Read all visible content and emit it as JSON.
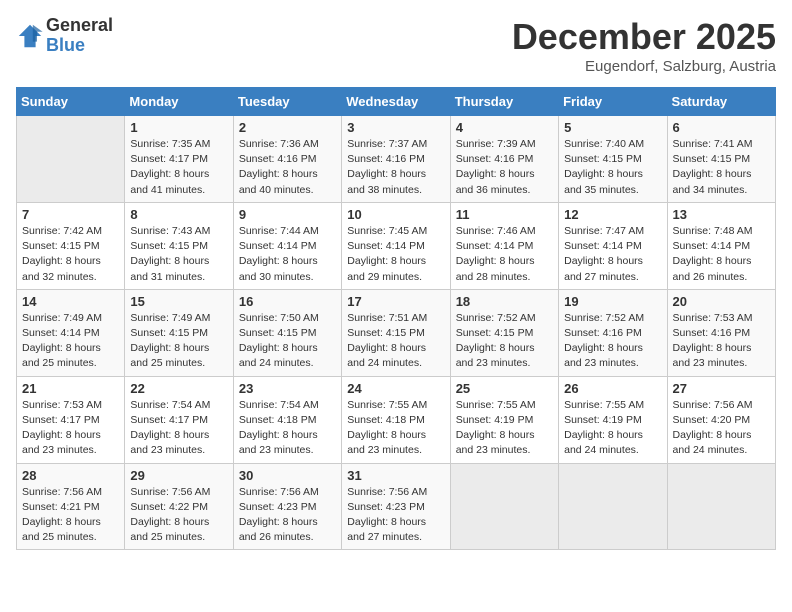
{
  "header": {
    "logo_general": "General",
    "logo_blue": "Blue",
    "month_title": "December 2025",
    "subtitle": "Eugendorf, Salzburg, Austria"
  },
  "days_of_week": [
    "Sunday",
    "Monday",
    "Tuesday",
    "Wednesday",
    "Thursday",
    "Friday",
    "Saturday"
  ],
  "weeks": [
    [
      {
        "day": "",
        "sunrise": "",
        "sunset": "",
        "daylight": "",
        "empty": true
      },
      {
        "day": "1",
        "sunrise": "Sunrise: 7:35 AM",
        "sunset": "Sunset: 4:17 PM",
        "daylight": "Daylight: 8 hours and 41 minutes."
      },
      {
        "day": "2",
        "sunrise": "Sunrise: 7:36 AM",
        "sunset": "Sunset: 4:16 PM",
        "daylight": "Daylight: 8 hours and 40 minutes."
      },
      {
        "day": "3",
        "sunrise": "Sunrise: 7:37 AM",
        "sunset": "Sunset: 4:16 PM",
        "daylight": "Daylight: 8 hours and 38 minutes."
      },
      {
        "day": "4",
        "sunrise": "Sunrise: 7:39 AM",
        "sunset": "Sunset: 4:16 PM",
        "daylight": "Daylight: 8 hours and 36 minutes."
      },
      {
        "day": "5",
        "sunrise": "Sunrise: 7:40 AM",
        "sunset": "Sunset: 4:15 PM",
        "daylight": "Daylight: 8 hours and 35 minutes."
      },
      {
        "day": "6",
        "sunrise": "Sunrise: 7:41 AM",
        "sunset": "Sunset: 4:15 PM",
        "daylight": "Daylight: 8 hours and 34 minutes."
      }
    ],
    [
      {
        "day": "7",
        "sunrise": "Sunrise: 7:42 AM",
        "sunset": "Sunset: 4:15 PM",
        "daylight": "Daylight: 8 hours and 32 minutes."
      },
      {
        "day": "8",
        "sunrise": "Sunrise: 7:43 AM",
        "sunset": "Sunset: 4:15 PM",
        "daylight": "Daylight: 8 hours and 31 minutes."
      },
      {
        "day": "9",
        "sunrise": "Sunrise: 7:44 AM",
        "sunset": "Sunset: 4:14 PM",
        "daylight": "Daylight: 8 hours and 30 minutes."
      },
      {
        "day": "10",
        "sunrise": "Sunrise: 7:45 AM",
        "sunset": "Sunset: 4:14 PM",
        "daylight": "Daylight: 8 hours and 29 minutes."
      },
      {
        "day": "11",
        "sunrise": "Sunrise: 7:46 AM",
        "sunset": "Sunset: 4:14 PM",
        "daylight": "Daylight: 8 hours and 28 minutes."
      },
      {
        "day": "12",
        "sunrise": "Sunrise: 7:47 AM",
        "sunset": "Sunset: 4:14 PM",
        "daylight": "Daylight: 8 hours and 27 minutes."
      },
      {
        "day": "13",
        "sunrise": "Sunrise: 7:48 AM",
        "sunset": "Sunset: 4:14 PM",
        "daylight": "Daylight: 8 hours and 26 minutes."
      }
    ],
    [
      {
        "day": "14",
        "sunrise": "Sunrise: 7:49 AM",
        "sunset": "Sunset: 4:14 PM",
        "daylight": "Daylight: 8 hours and 25 minutes."
      },
      {
        "day": "15",
        "sunrise": "Sunrise: 7:49 AM",
        "sunset": "Sunset: 4:15 PM",
        "daylight": "Daylight: 8 hours and 25 minutes."
      },
      {
        "day": "16",
        "sunrise": "Sunrise: 7:50 AM",
        "sunset": "Sunset: 4:15 PM",
        "daylight": "Daylight: 8 hours and 24 minutes."
      },
      {
        "day": "17",
        "sunrise": "Sunrise: 7:51 AM",
        "sunset": "Sunset: 4:15 PM",
        "daylight": "Daylight: 8 hours and 24 minutes."
      },
      {
        "day": "18",
        "sunrise": "Sunrise: 7:52 AM",
        "sunset": "Sunset: 4:15 PM",
        "daylight": "Daylight: 8 hours and 23 minutes."
      },
      {
        "day": "19",
        "sunrise": "Sunrise: 7:52 AM",
        "sunset": "Sunset: 4:16 PM",
        "daylight": "Daylight: 8 hours and 23 minutes."
      },
      {
        "day": "20",
        "sunrise": "Sunrise: 7:53 AM",
        "sunset": "Sunset: 4:16 PM",
        "daylight": "Daylight: 8 hours and 23 minutes."
      }
    ],
    [
      {
        "day": "21",
        "sunrise": "Sunrise: 7:53 AM",
        "sunset": "Sunset: 4:17 PM",
        "daylight": "Daylight: 8 hours and 23 minutes."
      },
      {
        "day": "22",
        "sunrise": "Sunrise: 7:54 AM",
        "sunset": "Sunset: 4:17 PM",
        "daylight": "Daylight: 8 hours and 23 minutes."
      },
      {
        "day": "23",
        "sunrise": "Sunrise: 7:54 AM",
        "sunset": "Sunset: 4:18 PM",
        "daylight": "Daylight: 8 hours and 23 minutes."
      },
      {
        "day": "24",
        "sunrise": "Sunrise: 7:55 AM",
        "sunset": "Sunset: 4:18 PM",
        "daylight": "Daylight: 8 hours and 23 minutes."
      },
      {
        "day": "25",
        "sunrise": "Sunrise: 7:55 AM",
        "sunset": "Sunset: 4:19 PM",
        "daylight": "Daylight: 8 hours and 23 minutes."
      },
      {
        "day": "26",
        "sunrise": "Sunrise: 7:55 AM",
        "sunset": "Sunset: 4:19 PM",
        "daylight": "Daylight: 8 hours and 24 minutes."
      },
      {
        "day": "27",
        "sunrise": "Sunrise: 7:56 AM",
        "sunset": "Sunset: 4:20 PM",
        "daylight": "Daylight: 8 hours and 24 minutes."
      }
    ],
    [
      {
        "day": "28",
        "sunrise": "Sunrise: 7:56 AM",
        "sunset": "Sunset: 4:21 PM",
        "daylight": "Daylight: 8 hours and 25 minutes."
      },
      {
        "day": "29",
        "sunrise": "Sunrise: 7:56 AM",
        "sunset": "Sunset: 4:22 PM",
        "daylight": "Daylight: 8 hours and 25 minutes."
      },
      {
        "day": "30",
        "sunrise": "Sunrise: 7:56 AM",
        "sunset": "Sunset: 4:23 PM",
        "daylight": "Daylight: 8 hours and 26 minutes."
      },
      {
        "day": "31",
        "sunrise": "Sunrise: 7:56 AM",
        "sunset": "Sunset: 4:23 PM",
        "daylight": "Daylight: 8 hours and 27 minutes."
      },
      {
        "day": "",
        "sunrise": "",
        "sunset": "",
        "daylight": "",
        "empty": true
      },
      {
        "day": "",
        "sunrise": "",
        "sunset": "",
        "daylight": "",
        "empty": true
      },
      {
        "day": "",
        "sunrise": "",
        "sunset": "",
        "daylight": "",
        "empty": true
      }
    ]
  ]
}
